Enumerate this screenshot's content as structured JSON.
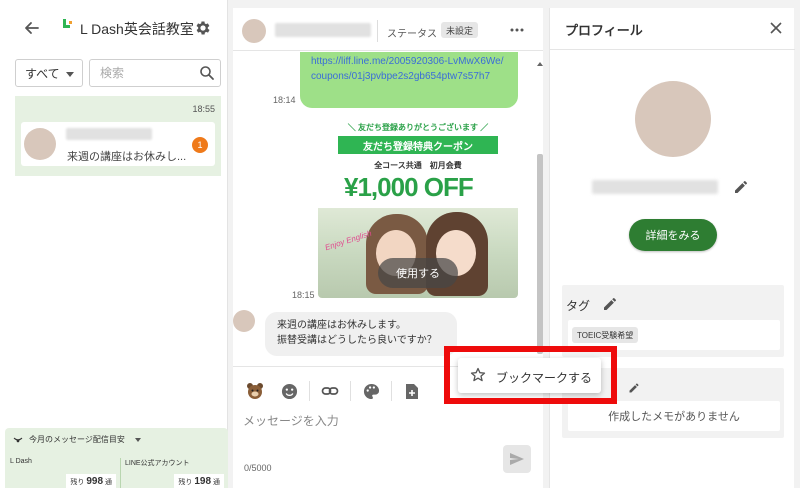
{
  "sidebar": {
    "brand_title": "L Dash英会話教室",
    "brand_logo_text": "L Dash",
    "filter_value": "すべて",
    "search_placeholder": "検索",
    "friend": {
      "time": "18:55",
      "preview": "来週の講座はお休みし...",
      "unread_count": "1"
    },
    "quota": {
      "header": "今月のメッセージ配信目安",
      "ldash_label": "L Dash",
      "ldash_prefix": "残り",
      "ldash_value": "998",
      "ldash_unit": "通",
      "line_label": "LINE公式アカウント",
      "line_prefix": "残り",
      "line_value": "198",
      "line_unit": "通"
    }
  },
  "chat": {
    "status_label": "ステータス",
    "status_value": "未設定",
    "link_text": "https://liff.line.me/2005920306-LvMwX6We/coupons/01j3pvbpe2s2gb654ptw7s57h7",
    "link_time": "18:14",
    "coupon": {
      "thanks": "＼ 友だち登録ありがとうございます ／",
      "title": "友だち登録特典クーポン",
      "subtitle": "全コース共通　初月会費",
      "amount": "¥1,000 OFF",
      "script": "Enjoy English",
      "use_button": "使用する"
    },
    "coupon_time": "18:15",
    "incoming_line1": "来週の講座はお休みします。",
    "incoming_line2": "振替受講はどうしたら良いですか？",
    "composer_placeholder": "メッセージを入力",
    "char_count": "0/5000"
  },
  "profile": {
    "title": "プロフィール",
    "detail_button": "詳細をみる",
    "tag_label": "タグ",
    "tag_chip": "TOEIC受験希望",
    "memo_empty": "作成したメモがありません"
  },
  "context_menu": {
    "bookmark_label": "ブックマークする"
  },
  "colors": {
    "accent_green": "#2e7d32",
    "bubble_green": "#9ee088",
    "badge_orange": "#ef7a1a",
    "highlight_red": "#ee0b0b",
    "list_bg": "#e6f1e2"
  }
}
